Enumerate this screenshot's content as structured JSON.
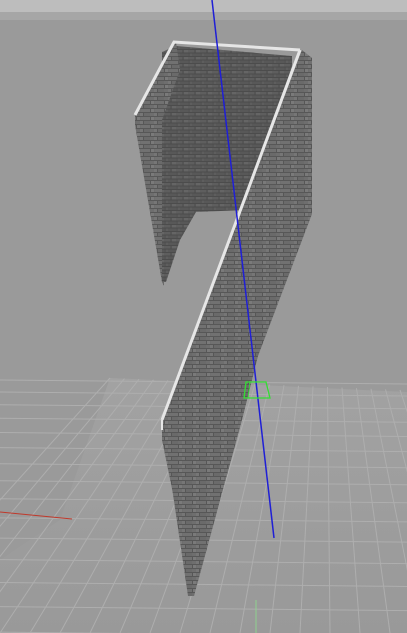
{
  "viewport": {
    "background_color": "#9a9a9a",
    "top_strip_color": "#bdbdbd",
    "ground_grid": {
      "visible": true,
      "line_color": "#aeaeae",
      "fill_color": "#9c9c9c"
    },
    "axes": {
      "x_axis_color": "#c0392b",
      "y_axis_color": "#8fd18f",
      "z_axis_color": "#1f1fd6"
    }
  },
  "scene": {
    "object": "brick-wall",
    "material": {
      "name": "brick",
      "face_color": "#6f6f6f",
      "top_edge_color": "#e6e6e6"
    },
    "selection_gizmo": {
      "color": "#33dd33",
      "visible": true
    }
  }
}
